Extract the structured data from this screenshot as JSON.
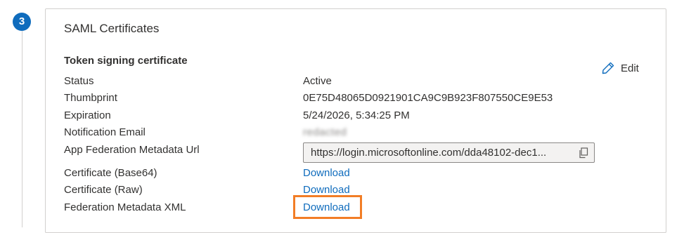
{
  "step": {
    "number": "3"
  },
  "card": {
    "title": "SAML Certificates",
    "section_title": "Token signing certificate",
    "edit_label": "Edit"
  },
  "rows": {
    "status": {
      "label": "Status",
      "value": "Active"
    },
    "thumbprint": {
      "label": "Thumbprint",
      "value": "0E75D48065D0921901CA9C9B923F807550CE9E53"
    },
    "expiration": {
      "label": "Expiration",
      "value": "5/24/2026, 5:34:25 PM"
    },
    "notification_email": {
      "label": "Notification Email",
      "value": "redacted"
    },
    "metadata_url": {
      "label": "App Federation Metadata Url",
      "value": "https://login.microsoftonline.com/dda48102-dec1..."
    },
    "cert_base64": {
      "label": "Certificate (Base64)",
      "link": "Download"
    },
    "cert_raw": {
      "label": "Certificate (Raw)",
      "link": "Download"
    },
    "federation_xml": {
      "label": "Federation Metadata XML",
      "link": "Download"
    }
  },
  "icons": {
    "edit": "pencil-icon",
    "copy": "copy-icon"
  },
  "colors": {
    "accent": "#0f6cbd",
    "highlight": "#f27d26"
  }
}
